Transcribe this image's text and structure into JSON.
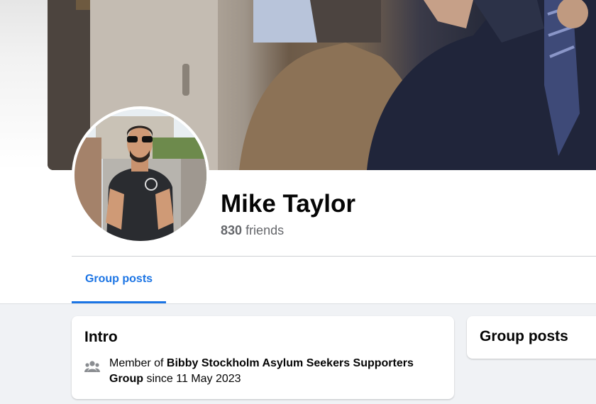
{
  "profile": {
    "name": "Mike Taylor",
    "friends_count": "830",
    "friends_label": "friends"
  },
  "tabs": [
    {
      "label": "Group posts",
      "active": true
    }
  ],
  "intro": {
    "title": "Intro",
    "membership": {
      "prefix": "Member of ",
      "group_name": "Bibby Stockholm Asylum Seekers Supporters Group",
      "suffix": " since 11 May 2023",
      "icon": "group-icon"
    }
  },
  "group_posts": {
    "title": "Group posts"
  },
  "colors": {
    "accent": "#1b74e4",
    "feed_background": "#f0f2f5",
    "secondary_text": "#65676b"
  }
}
